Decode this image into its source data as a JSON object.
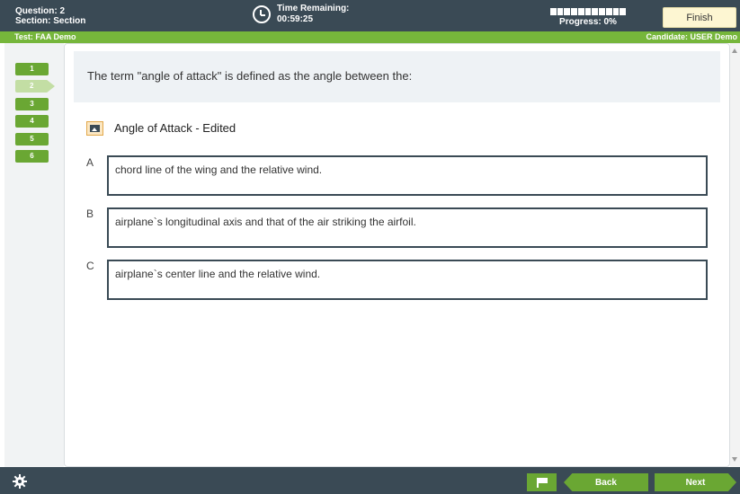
{
  "header": {
    "question_label": "Question: 2",
    "section_label": "Section: Section",
    "time_label": "Time Remaining:",
    "time_value": "00:59:25",
    "progress_label": "Progress: 0%",
    "progress_fraction": 0,
    "finish_label": "Finish"
  },
  "info_bar": {
    "test": "Test: FAA Demo",
    "candidate": "Candidate: USER Demo"
  },
  "nav": {
    "items": [
      "1",
      "2",
      "3",
      "4",
      "5",
      "6"
    ],
    "current": "2"
  },
  "question": {
    "text": "The term \"angle of attack\" is defined as the angle between the:",
    "image_label": "Angle of Attack - Edited",
    "options": [
      {
        "letter": "A",
        "text": "chord line of the wing and the relative wind."
      },
      {
        "letter": "B",
        "text": "airplane`s longitudinal axis and that of the air striking the airfoil."
      },
      {
        "letter": "C",
        "text": "airplane`s center line and the relative wind."
      }
    ]
  },
  "footer": {
    "back_label": "Back",
    "next_label": "Next",
    "icons": [
      "gear-icon",
      "flag-icon"
    ]
  },
  "colors": {
    "dark": "#3a4a55",
    "green": "#76b63b",
    "finish_bg": "#fdf6d2"
  }
}
